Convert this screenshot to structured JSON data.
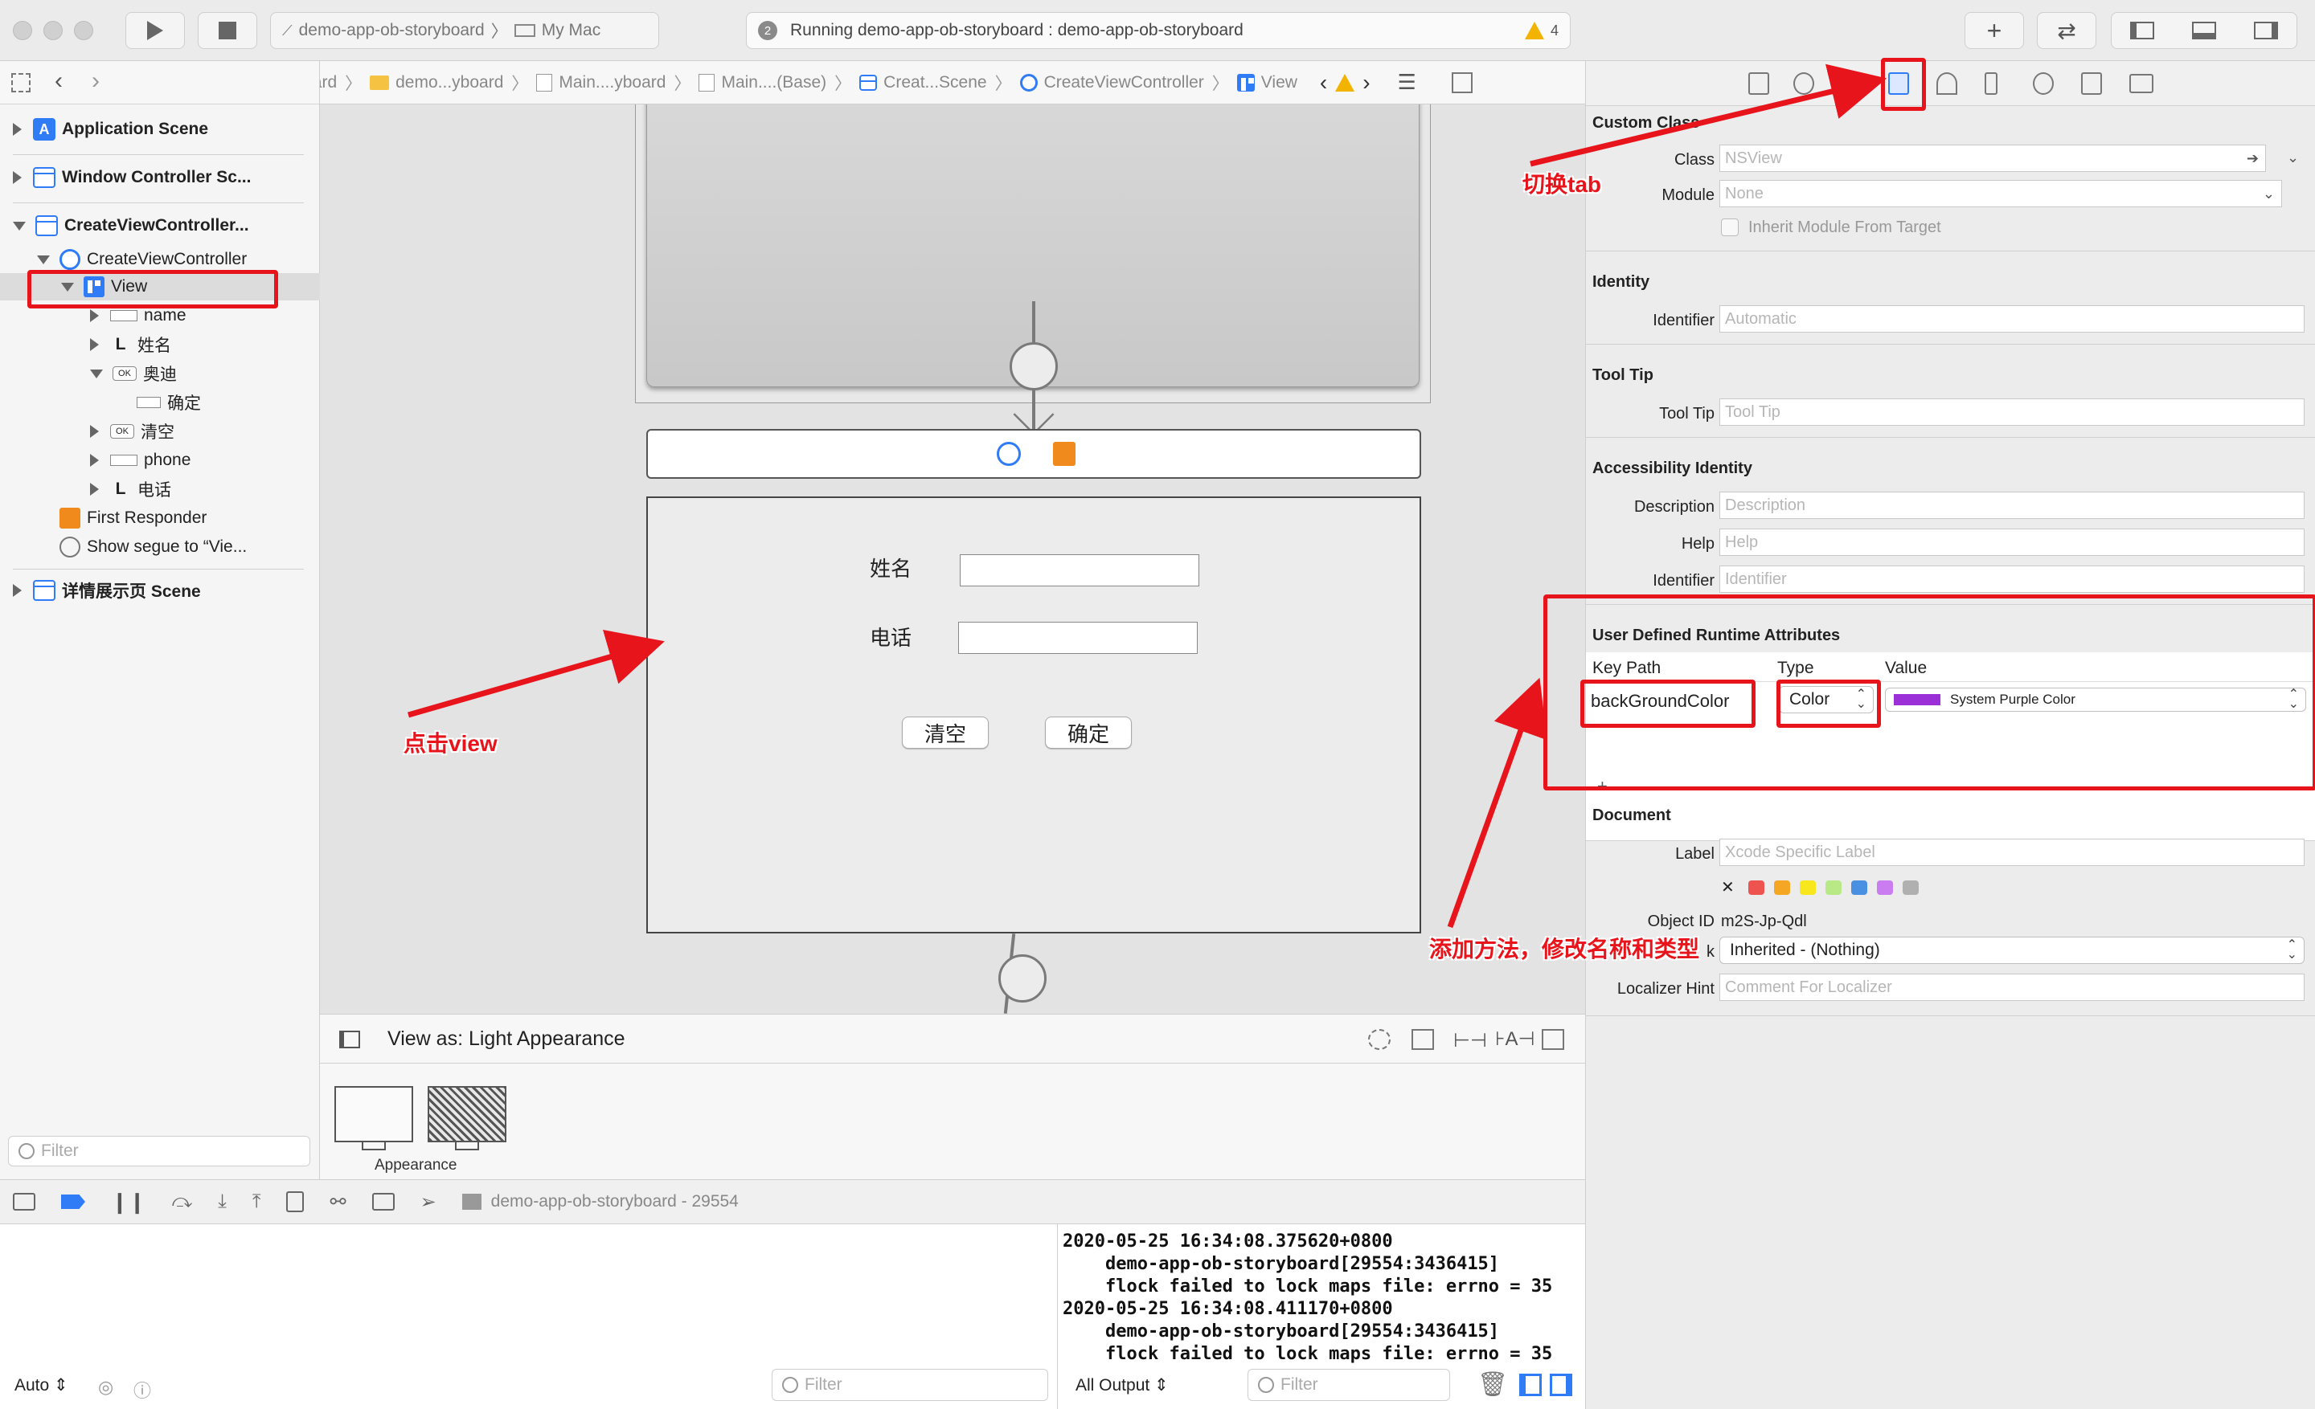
{
  "toolbar": {
    "scheme_name": "demo-app-ob-storyboard",
    "destination": "My Mac",
    "status_num": "2",
    "status_text": "Running demo-app-ob-storyboard : demo-app-ob-storyboard",
    "warning_count": "4",
    "add_label": "+",
    "swap_label": "⇄"
  },
  "jumpbar": {
    "items": [
      "demo-app-ob-storyboard",
      "demo...yboard",
      "Main....yboard",
      "Main....(Base)",
      "Creat...Scene",
      "CreateViewController",
      "View"
    ]
  },
  "navigator": {
    "rows": [
      {
        "label": "Application Scene"
      },
      {
        "label": "Window Controller Sc..."
      },
      {
        "label": "CreateViewController..."
      },
      {
        "label": "CreateViewController"
      },
      {
        "label": "View"
      },
      {
        "label": "name"
      },
      {
        "label": "姓名",
        "glyph": "L"
      },
      {
        "label": "奥迪",
        "glyph": "OK"
      },
      {
        "label": "确定"
      },
      {
        "label": "清空",
        "glyph": "OK"
      },
      {
        "label": "phone"
      },
      {
        "label": "电话",
        "glyph": "L"
      },
      {
        "label": "First Responder"
      },
      {
        "label": "Show segue to “Vie..."
      },
      {
        "label": "详情展示页 Scene"
      }
    ],
    "filter_placeholder": "Filter"
  },
  "canvas": {
    "name_label": "姓名",
    "phone_label": "电话",
    "clear_button": "清空",
    "confirm_button": "确定",
    "view_as": "View as: Light Appearance",
    "appearance_label": "Appearance"
  },
  "debug": {
    "process": "demo-app-ob-storyboard - 29554",
    "console_text": "2020-05-25 16:34:08.375620+0800\n    demo-app-ob-storyboard[29554:3436415]\n    flock failed to lock maps file: errno = 35\n2020-05-25 16:34:08.411170+0800\n    demo-app-ob-storyboard[29554:3436415]\n    flock failed to lock maps file: errno = 35",
    "auto_label": "Auto",
    "filter_placeholder": "Filter",
    "output_label": "All Output"
  },
  "inspector": {
    "custom_class_title": "Custom Class",
    "class_label": "Class",
    "class_placeholder": "NSView",
    "module_label": "Module",
    "module_placeholder": "None",
    "inherit_label": "Inherit Module From Target",
    "identity_title": "Identity",
    "identifier_label": "Identifier",
    "identifier_placeholder": "Automatic",
    "tooltip_title": "Tool Tip",
    "tooltip_label": "Tool Tip",
    "tooltip_placeholder": "Tool Tip",
    "accessibility_title": "Accessibility Identity",
    "description_label": "Description",
    "description_placeholder": "Description",
    "help_label": "Help",
    "help_placeholder": "Help",
    "acc_identifier_label": "Identifier",
    "acc_identifier_placeholder": "Identifier",
    "udra_title": "User Defined Runtime Attributes",
    "col_keypath": "Key Path",
    "col_type": "Type",
    "col_value": "Value",
    "keypath_value": "backGroundColor",
    "type_value": "Color",
    "color_value": "System Purple Color",
    "document_title": "Document",
    "doc_label_label": "Label",
    "doc_label_placeholder": "Xcode Specific Label",
    "clear_x": "✕",
    "object_id_label": "Object ID",
    "object_id_value": "m2S-Jp-Qdl",
    "lock_label_suffix": "k",
    "lock_value": "Inherited - (Nothing)",
    "localizer_label": "Localizer Hint",
    "localizer_placeholder": "Comment For Localizer",
    "swatch_colors": [
      "#ef5350",
      "#f5a623",
      "#f8e71c",
      "#b8e986",
      "#4a90e2",
      "#c97df0",
      "#b0b0b0"
    ],
    "purple": "#9b30d9"
  },
  "annotations": {
    "switch_tab": "切换tab",
    "click_view": "点击view",
    "add_method": "添加方法，修改名称和类型"
  }
}
